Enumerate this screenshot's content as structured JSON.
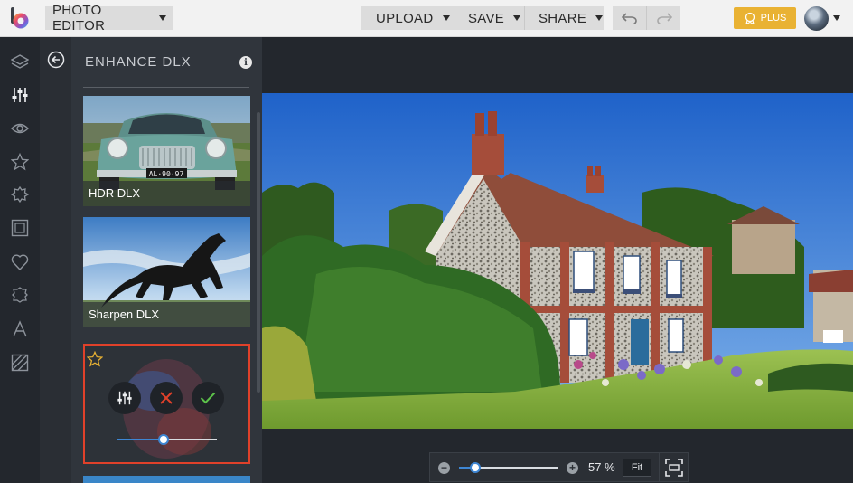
{
  "app": {
    "mode_label": "PHOTO EDITOR",
    "logo": "befunky-logo"
  },
  "toolbar": {
    "upload_label": "UPLOAD",
    "save_label": "SAVE",
    "share_label": "SHARE",
    "undo_icon": "undo-icon",
    "redo_icon": "redo-icon",
    "plus_label": "PLUS",
    "accent_color": "#e9b233"
  },
  "rail": {
    "items": [
      {
        "name": "layers-icon"
      },
      {
        "name": "edit-sliders-icon"
      },
      {
        "name": "eye-icon"
      },
      {
        "name": "star-icon"
      },
      {
        "name": "badge-icon"
      },
      {
        "name": "frame-icon"
      },
      {
        "name": "heart-icon"
      },
      {
        "name": "puzzle-icon"
      },
      {
        "name": "text-icon"
      },
      {
        "name": "texture-icon"
      }
    ],
    "active_index": 1
  },
  "panel": {
    "title": "ENHANCE DLX",
    "effects": [
      {
        "label": "HDR DLX"
      },
      {
        "label": "Sharpen DLX"
      }
    ],
    "selected_effect": {
      "amount": 0.47,
      "highlight_color": "#e0412a"
    }
  },
  "zoom": {
    "percent_label": "57 %",
    "fit_label": "Fit",
    "level": 0.16,
    "accent_color": "#3e86d3"
  }
}
